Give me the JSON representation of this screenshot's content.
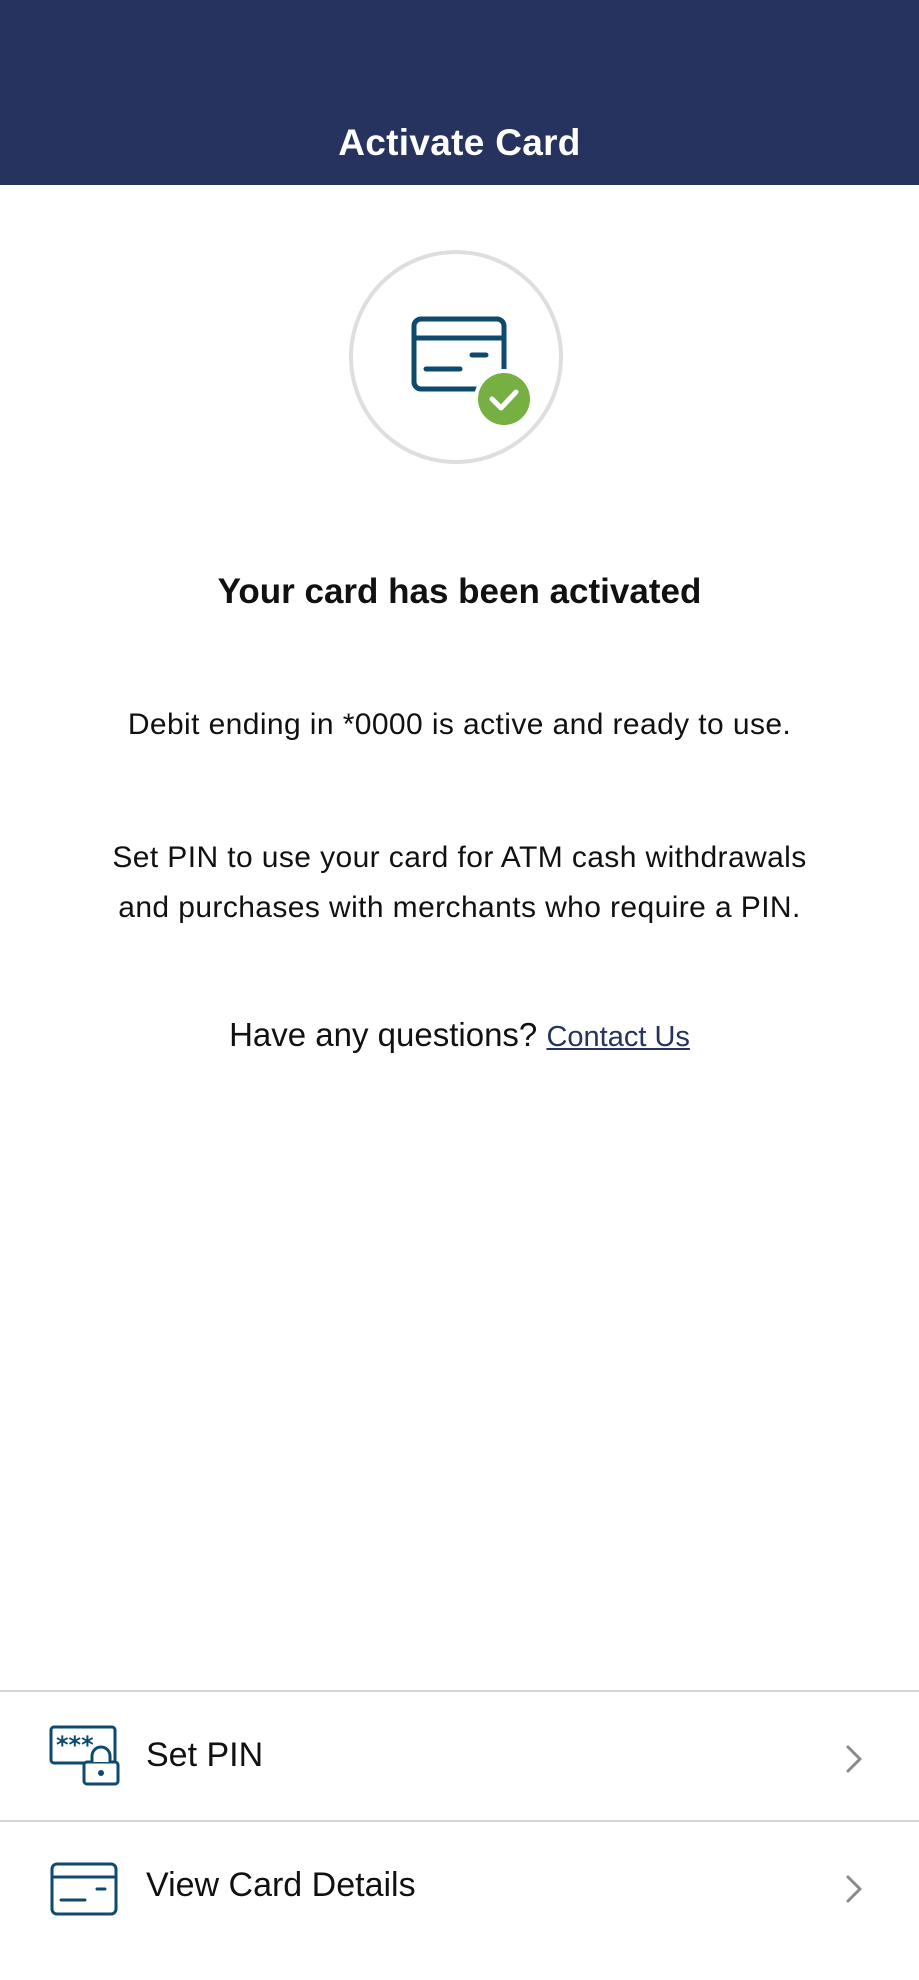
{
  "header": {
    "title": "Activate Card"
  },
  "hero": {
    "icon": "card-activated-icon",
    "badge_icon": "check-icon",
    "card_color": "#0e4a6e",
    "badge_color": "#76b043"
  },
  "main": {
    "headline": "Your card has been activated",
    "status_message": "Debit ending in *0000 is active and ready to use.",
    "pin_message_line1": "Set PIN to use your card for ATM cash withdrawals",
    "pin_message_line2": "and purchases with merchants who require a PIN.",
    "questions_prompt": "Have any questions?",
    "contact_link": "Contact Us"
  },
  "actions": [
    {
      "label": "Set PIN",
      "icon": "pin-lock-icon"
    },
    {
      "label": "View Card Details",
      "icon": "card-icon"
    }
  ],
  "colors": {
    "header_bg": "#25335e",
    "link": "#25335e",
    "divider": "#d4d4d4"
  }
}
